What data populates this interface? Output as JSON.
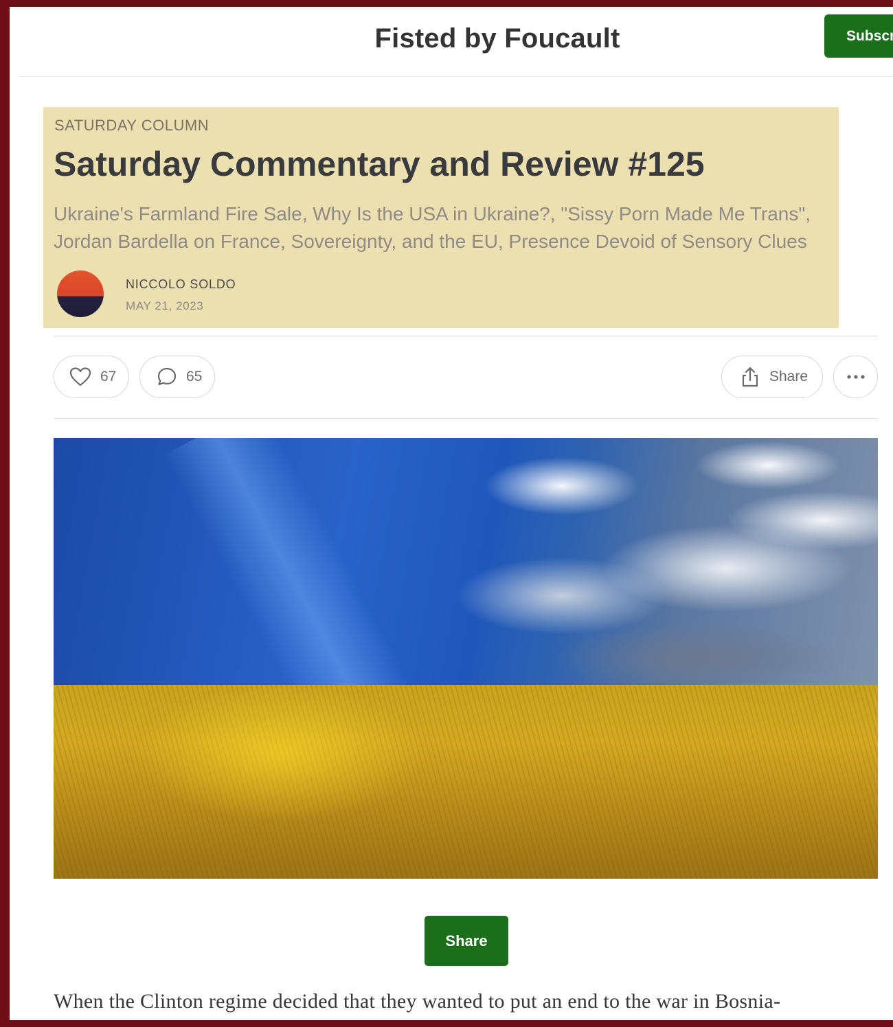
{
  "header": {
    "site_title": "Fisted by Foucault",
    "subscribe_label": "Subscr"
  },
  "post": {
    "section": "SATURDAY COLUMN",
    "title": "Saturday Commentary and Review #125",
    "subtitle": "Ukraine's Farmland Fire Sale, Why Is the USA in Ukraine?, \"Sissy Porn Made Me Trans\", Jordan Bardella on France, Sovereignty, and the EU, Presence Devoid of Sensory Clues",
    "author": "NICCOLO SOLDO",
    "date": "MAY 21, 2023",
    "header_bg": "#ede0b0"
  },
  "actions": {
    "likes": "67",
    "comments": "65",
    "share_label": "Share",
    "more_icon": "ellipsis-icon"
  },
  "hero_image": {
    "description_icon": "wheat-field-under-sky-image"
  },
  "share_button_label": "Share",
  "body": {
    "first_line": "When the Clinton regime decided that they wanted to put an end to the war in Bosnia-"
  },
  "colors": {
    "frame": "#6e0f17",
    "accent_green": "#1b6f1b"
  }
}
